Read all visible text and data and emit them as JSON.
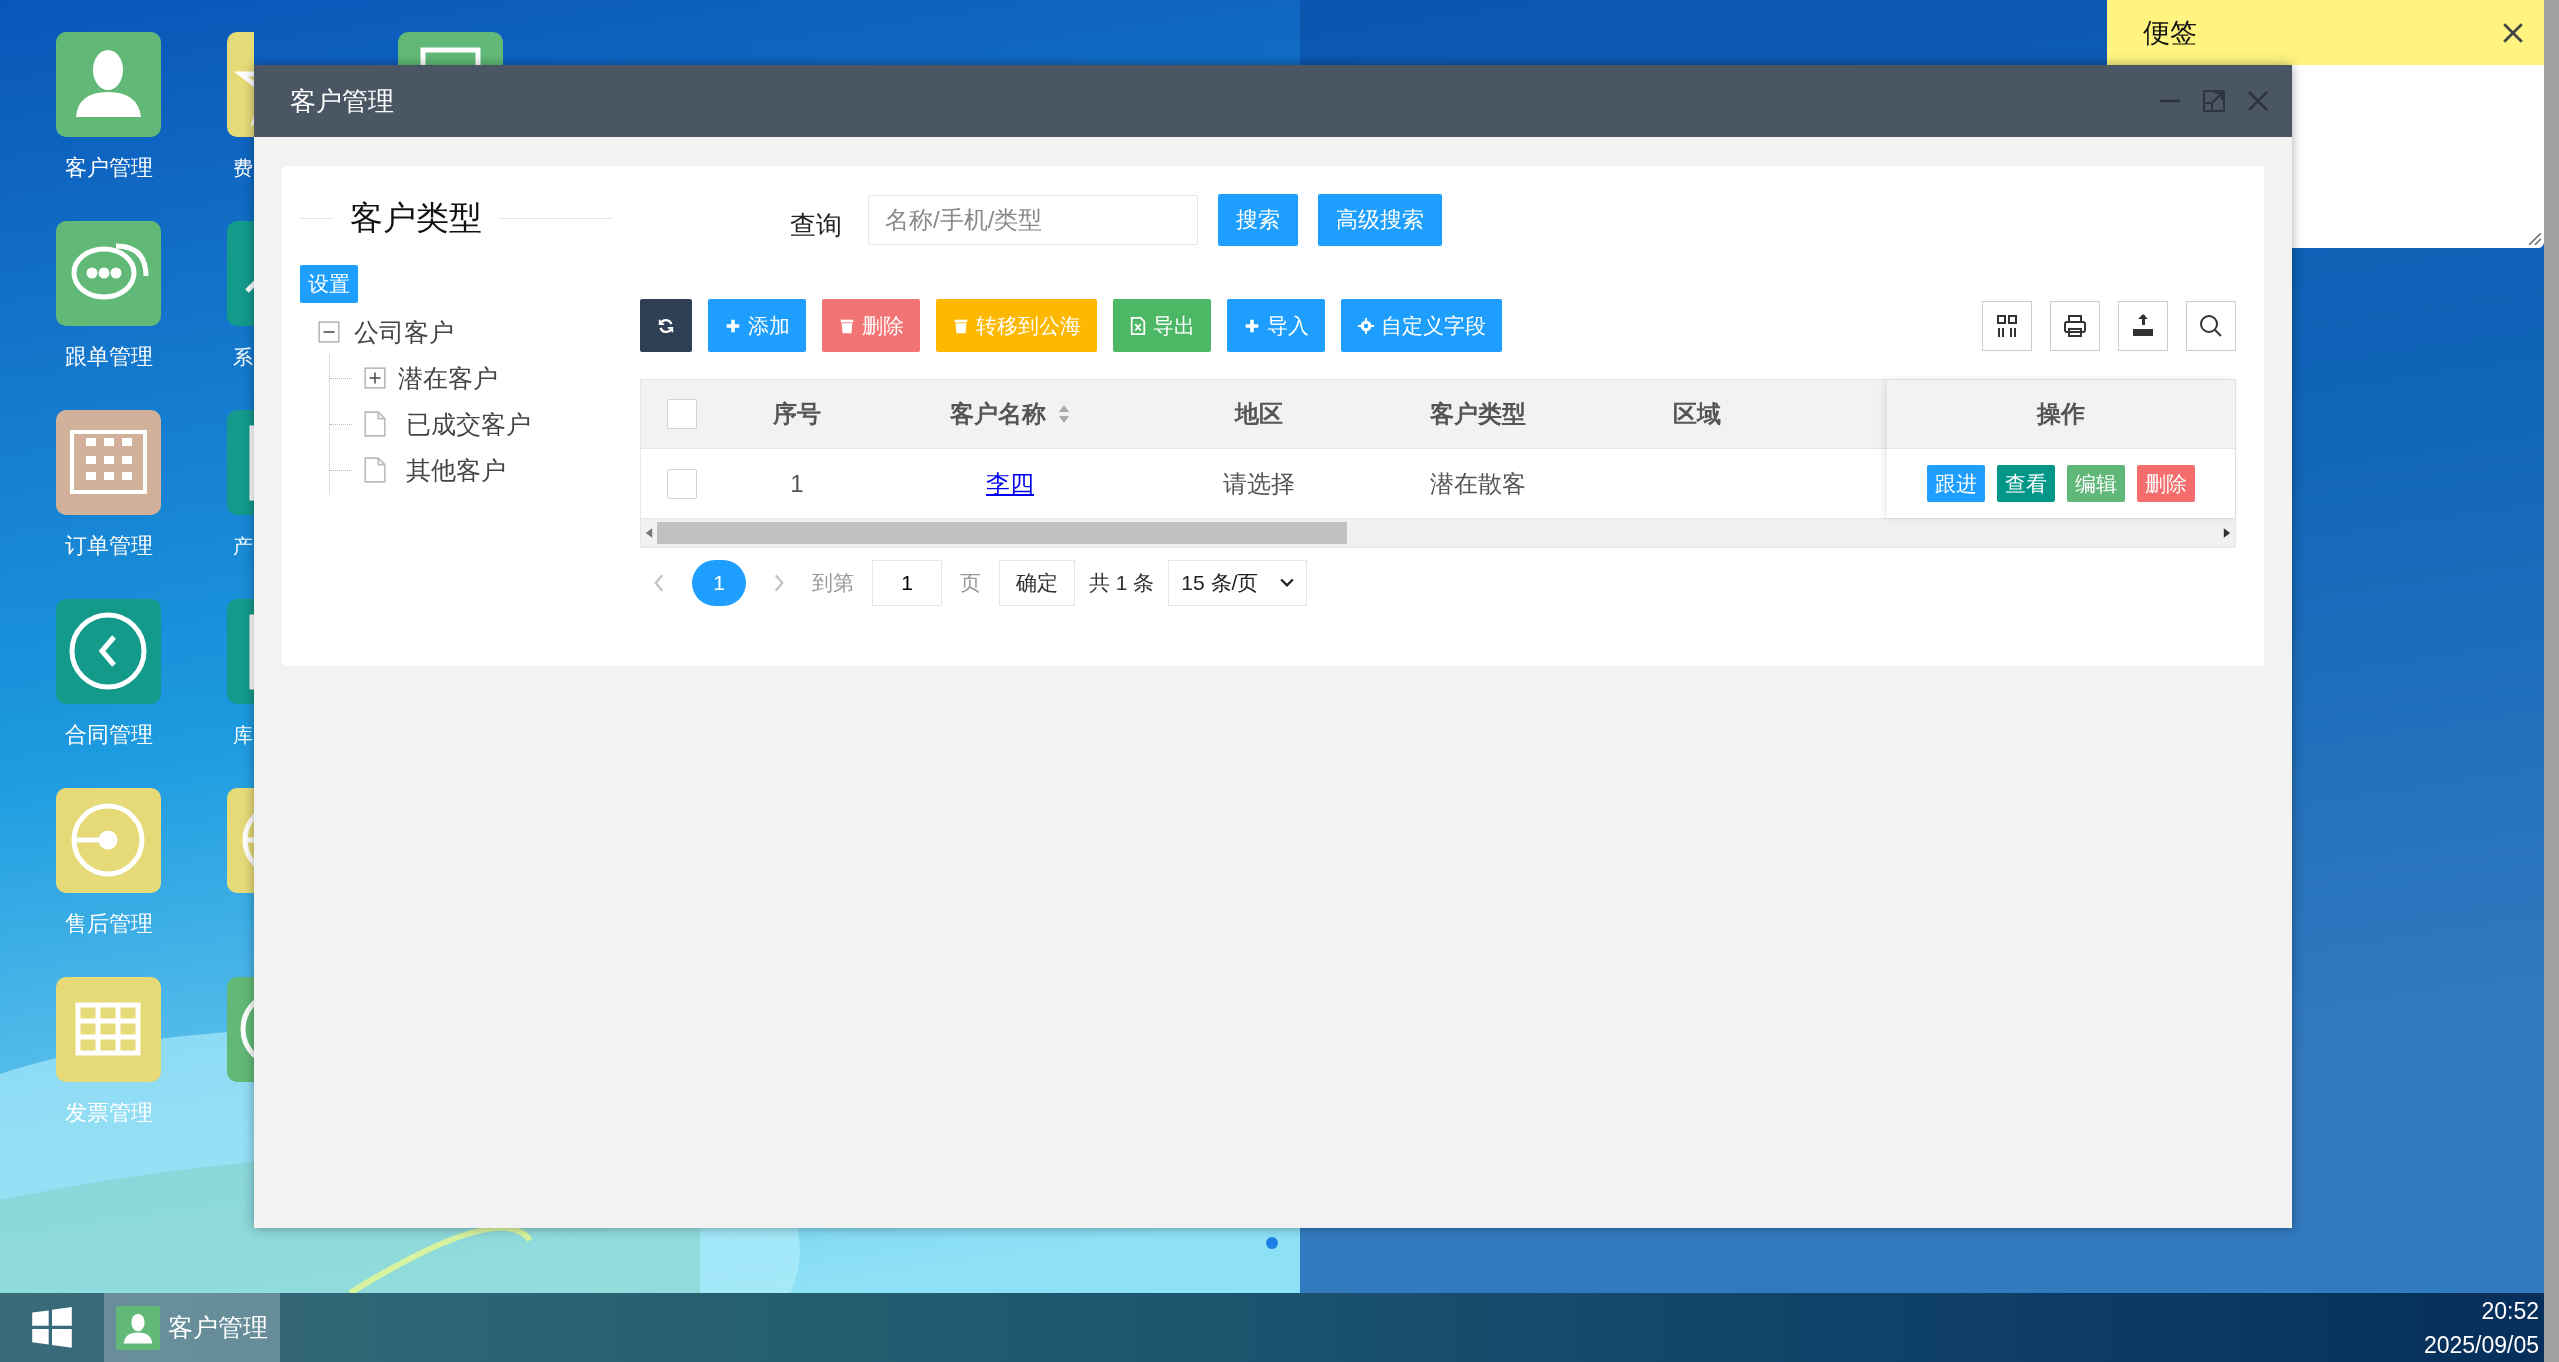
{
  "desktop_icons": [
    {
      "label": "客户管理",
      "color": "#62b977",
      "kind": "person"
    },
    {
      "label": "跟单管理",
      "color": "#62b977",
      "kind": "chat"
    },
    {
      "label": "订单管理",
      "color": "#d1b19a",
      "kind": "calendar"
    },
    {
      "label": "合同管理",
      "color": "#149a8b",
      "kind": "back"
    },
    {
      "label": "售后管理",
      "color": "#e6da78",
      "kind": "gauge"
    },
    {
      "label": "发票管理",
      "color": "#e6da78",
      "kind": "grid"
    },
    {
      "label": "费",
      "color": "#e6da78",
      "kind": "star"
    },
    {
      "label": "系",
      "color": "#149a8b",
      "kind": "arrow"
    },
    {
      "label": "产",
      "color": "#149a8b",
      "kind": "doc"
    },
    {
      "label": "库",
      "color": "#149a8b",
      "kind": "doc"
    },
    {
      "color": "#e6da78",
      "kind": "gauge"
    },
    {
      "color": "#62b977",
      "kind": "back"
    },
    {
      "color": "#62b977",
      "kind": "doc"
    }
  ],
  "sticky_note": {
    "title": "便签"
  },
  "window": {
    "title": "客户管理"
  },
  "tree_title": "客户类型",
  "settings_button": "设置",
  "tree": [
    {
      "label": "公司客户",
      "kind": "folder",
      "expanded": true,
      "children": [
        {
          "label": "潜在客户",
          "kind": "folder",
          "expanded": false
        },
        {
          "label": "已成交客户",
          "kind": "leaf"
        },
        {
          "label": "其他客户",
          "kind": "leaf"
        }
      ]
    }
  ],
  "search": {
    "label": "查询",
    "placeholder": "名称/手机/类型",
    "buttons": [
      "搜索",
      "高级搜索"
    ]
  },
  "toolbar": [
    {
      "kind": "refresh",
      "color": "#2f4056"
    },
    {
      "kind": "add",
      "label": "添加",
      "color": "#1e9fff"
    },
    {
      "kind": "delete",
      "label": "删除",
      "color": "#f37474"
    },
    {
      "kind": "delete",
      "label": "转移到公海",
      "color": "#ffb800"
    },
    {
      "kind": "export",
      "label": "导出",
      "color": "#4cb865"
    },
    {
      "kind": "add",
      "label": "导入",
      "color": "#1e9fff"
    },
    {
      "kind": "settings",
      "label": "自定义字段",
      "color": "#1e9fff"
    }
  ],
  "table": {
    "header_checked": false,
    "columns": [
      {
        "label": "序号",
        "sortable": false
      },
      {
        "label": "客户名称",
        "sortable": true
      },
      {
        "label": "地区",
        "sortable": false
      },
      {
        "label": "客户类型",
        "sortable": false
      },
      {
        "label": "区域",
        "sortable": false
      }
    ],
    "action_column": "操作",
    "rows": [
      {
        "checked": false,
        "index": "1",
        "name": "李四",
        "region": "请选择",
        "type": "潜在散客",
        "actions": [
          {
            "label": "跟进",
            "color": "#1e9fff"
          },
          {
            "label": "查看",
            "color": "#009688"
          },
          {
            "label": "编辑",
            "color": "#5fb878"
          },
          {
            "label": "删除",
            "color": "#f56c6c"
          }
        ]
      }
    ]
  },
  "pagination": {
    "pages": [
      {
        "label": "1",
        "selected": true
      }
    ],
    "goto_label": "到第",
    "goto_value": "1",
    "page_unit": "页",
    "confirm": "确定",
    "total": "共 1 条",
    "page_size": "15 条/页"
  },
  "taskbar": {
    "apps": [
      {
        "label": "客户管理",
        "selected": true
      }
    ],
    "time": "20:52",
    "date": "2025/09/05"
  }
}
